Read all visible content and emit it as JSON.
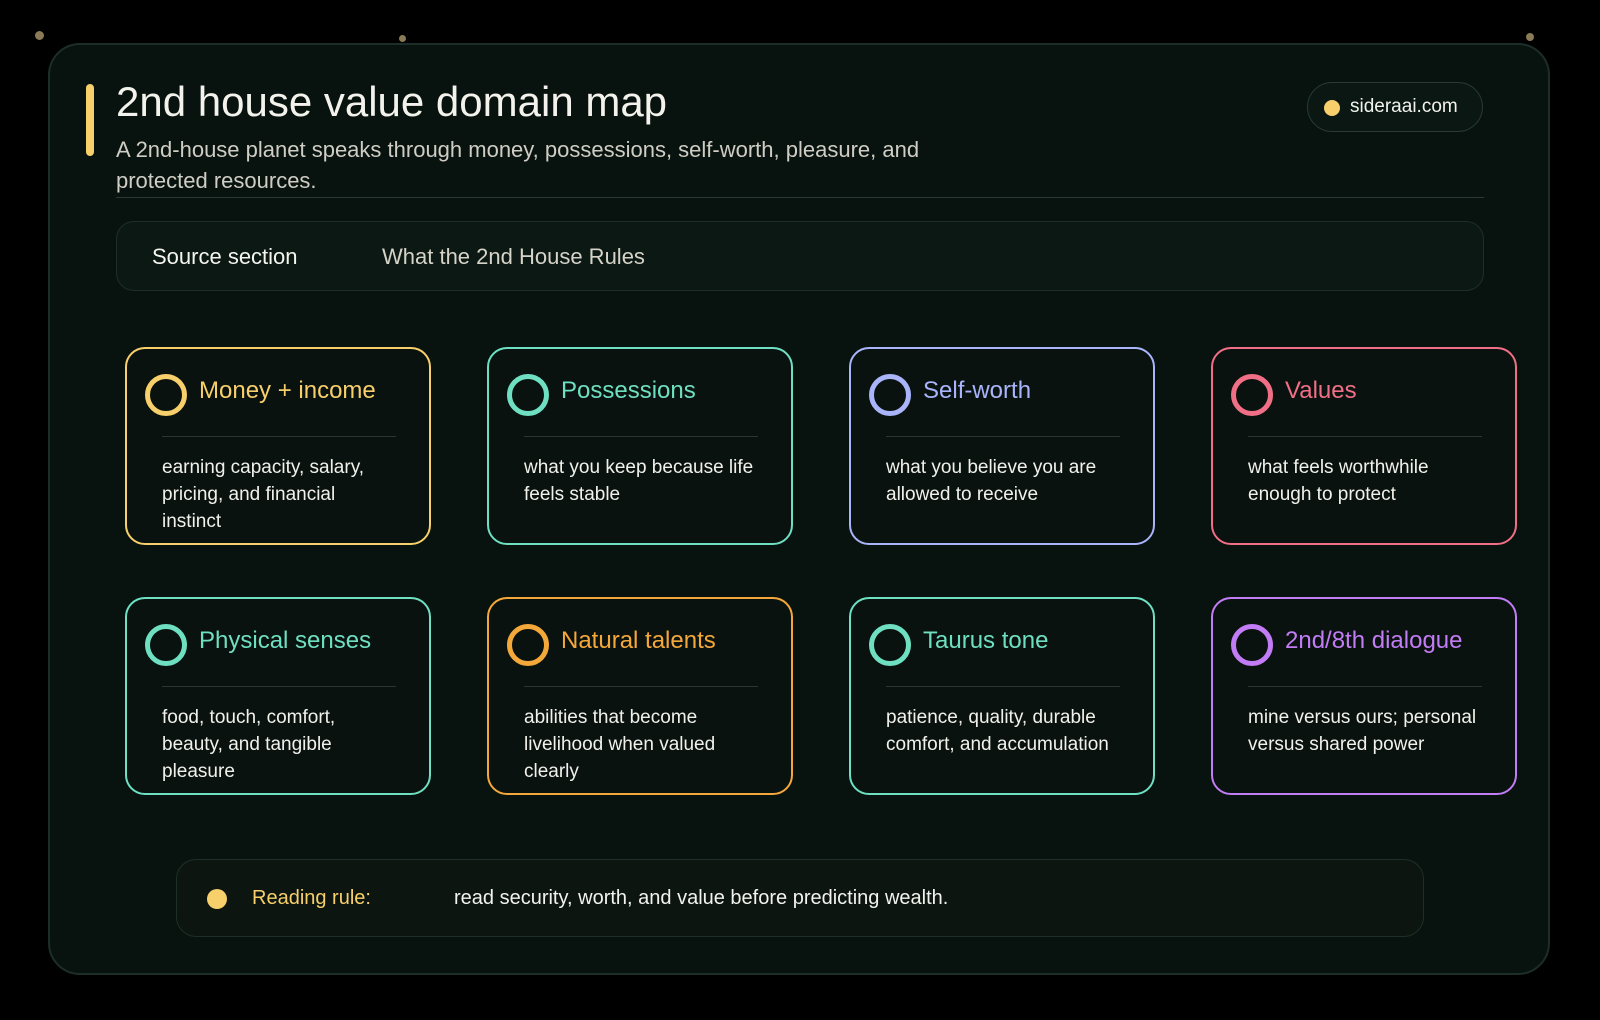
{
  "header": {
    "title": "2nd house value domain map",
    "subtitle": "A 2nd-house planet speaks through money, possessions, self-worth, pleasure, and protected resources.",
    "brand": "sideraai.com"
  },
  "source": {
    "label": "Source section",
    "value": "What the 2nd House Rules"
  },
  "colors": {
    "gold": "#f7cf6b",
    "teal": "#6ee0c1",
    "lavender": "#a9b4fb",
    "pink": "#f06f86",
    "orange": "#f5a83a",
    "purple": "#c27cf5"
  },
  "cards": [
    {
      "title": "Money + income",
      "body": "earning capacity, salary, pricing, and financial instinct",
      "color": "#f7cf6b"
    },
    {
      "title": "Possessions",
      "body": "what you keep because life feels stable",
      "color": "#6ee0c1"
    },
    {
      "title": "Self-worth",
      "body": "what you believe you are allowed to receive",
      "color": "#a9b4fb"
    },
    {
      "title": "Values",
      "body": "what feels worthwhile enough to protect",
      "color": "#f06f86"
    },
    {
      "title": "Physical senses",
      "body": "food, touch, comfort, beauty, and tangible pleasure",
      "color": "#6ee0c1"
    },
    {
      "title": "Natural talents",
      "body": "abilities that become livelihood when valued clearly",
      "color": "#f5a83a"
    },
    {
      "title": "Taurus tone",
      "body": "patience, quality, durable comfort, and accumulation",
      "color": "#6ee0c1"
    },
    {
      "title": "2nd/8th dialogue",
      "body": "mine versus ours; personal versus shared power",
      "color": "#c27cf5"
    }
  ],
  "footer": {
    "label": "Reading rule:",
    "text": "read security, worth, and value before predicting wealth."
  }
}
